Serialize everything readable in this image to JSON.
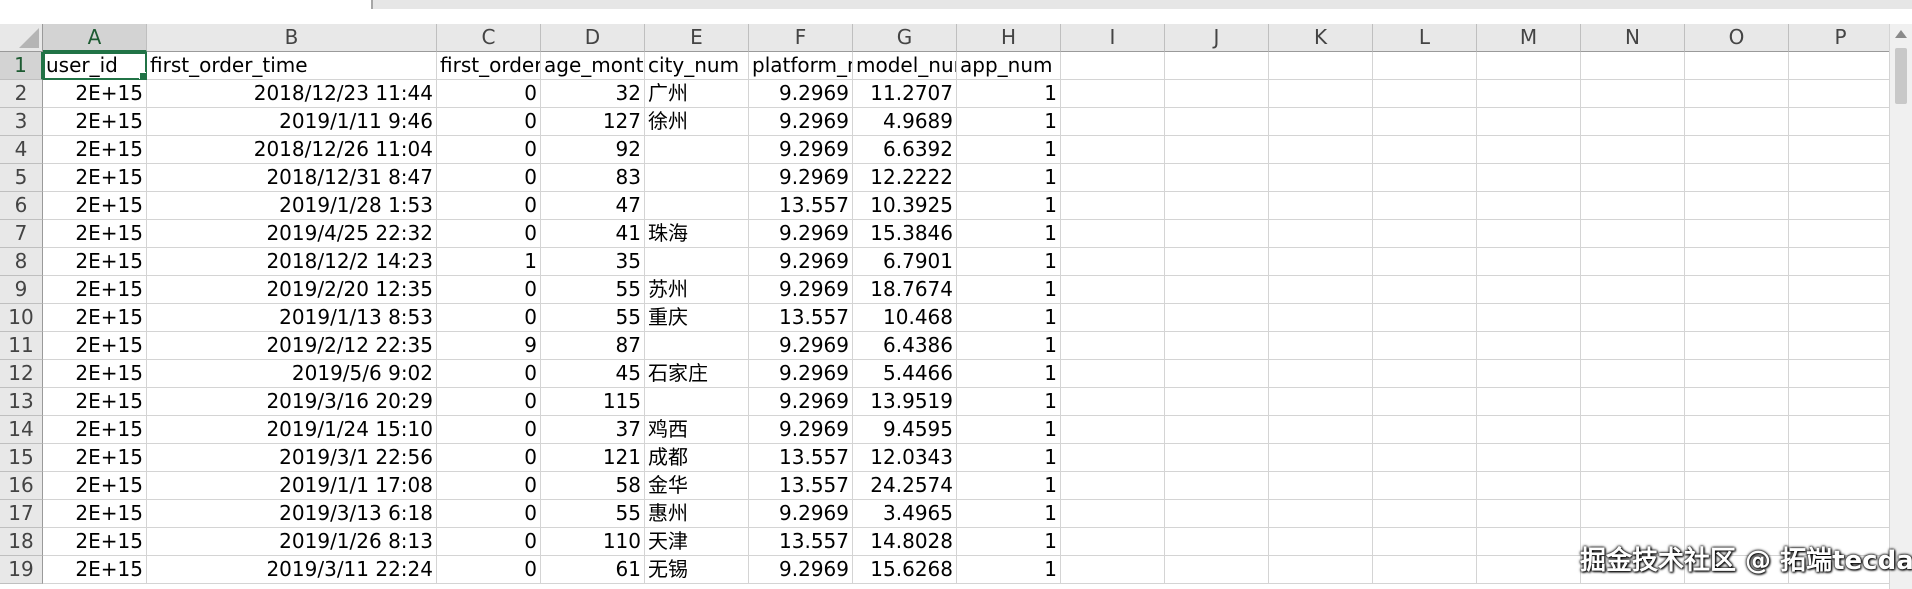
{
  "columns": [
    "A",
    "B",
    "C",
    "D",
    "E",
    "F",
    "G",
    "H",
    "I",
    "J",
    "K",
    "L",
    "M",
    "N",
    "O",
    "P"
  ],
  "row_numbers": [
    "1",
    "2",
    "3",
    "4",
    "5",
    "6",
    "7",
    "8",
    "9",
    "10",
    "11",
    "12",
    "13",
    "14",
    "15",
    "16",
    "17",
    "18",
    "19"
  ],
  "header_row": [
    "user_id",
    "first_order_time",
    "first_order_",
    "age_montl",
    "city_num",
    "platform_n",
    "model_nur",
    "app_num"
  ],
  "rows": [
    [
      "2E+15",
      "2018/12/23 11:44",
      "0",
      "32",
      "广州",
      "9.2969",
      "11.2707",
      "1"
    ],
    [
      "2E+15",
      "2019/1/11 9:46",
      "0",
      "127",
      "徐州",
      "9.2969",
      "4.9689",
      "1"
    ],
    [
      "2E+15",
      "2018/12/26 11:04",
      "0",
      "92",
      "",
      "9.2969",
      "6.6392",
      "1"
    ],
    [
      "2E+15",
      "2018/12/31 8:47",
      "0",
      "83",
      "",
      "9.2969",
      "12.2222",
      "1"
    ],
    [
      "2E+15",
      "2019/1/28 1:53",
      "0",
      "47",
      "",
      "13.557",
      "10.3925",
      "1"
    ],
    [
      "2E+15",
      "2019/4/25 22:32",
      "0",
      "41",
      "珠海",
      "9.2969",
      "15.3846",
      "1"
    ],
    [
      "2E+15",
      "2018/12/2 14:23",
      "1",
      "35",
      "",
      "9.2969",
      "6.7901",
      "1"
    ],
    [
      "2E+15",
      "2019/2/20 12:35",
      "0",
      "55",
      "苏州",
      "9.2969",
      "18.7674",
      "1"
    ],
    [
      "2E+15",
      "2019/1/13 8:53",
      "0",
      "55",
      "重庆",
      "13.557",
      "10.468",
      "1"
    ],
    [
      "2E+15",
      "2019/2/12 22:35",
      "9",
      "87",
      "",
      "9.2969",
      "6.4386",
      "1"
    ],
    [
      "2E+15",
      "2019/5/6 9:02",
      "0",
      "45",
      "石家庄",
      "9.2969",
      "5.4466",
      "1"
    ],
    [
      "2E+15",
      "2019/3/16 20:29",
      "0",
      "115",
      "",
      "9.2969",
      "13.9519",
      "1"
    ],
    [
      "2E+15",
      "2019/1/24 15:10",
      "0",
      "37",
      "鸡西",
      "9.2969",
      "9.4595",
      "1"
    ],
    [
      "2E+15",
      "2019/3/1 22:56",
      "0",
      "121",
      "成都",
      "13.557",
      "12.0343",
      "1"
    ],
    [
      "2E+15",
      "2019/1/1 17:08",
      "0",
      "58",
      "金华",
      "13.557",
      "24.2574",
      "1"
    ],
    [
      "2E+15",
      "2019/3/13 6:18",
      "0",
      "55",
      "惠州",
      "9.2969",
      "3.4965",
      "1"
    ],
    [
      "2E+15",
      "2019/1/26 8:13",
      "0",
      "110",
      "天津",
      "13.557",
      "14.8028",
      "1"
    ],
    [
      "2E+15",
      "2019/3/11 22:24",
      "0",
      "61",
      "无锡",
      "9.2969",
      "15.6268",
      "1"
    ]
  ],
  "watermark": "掘金技术社区 @ 拓端tecdat"
}
